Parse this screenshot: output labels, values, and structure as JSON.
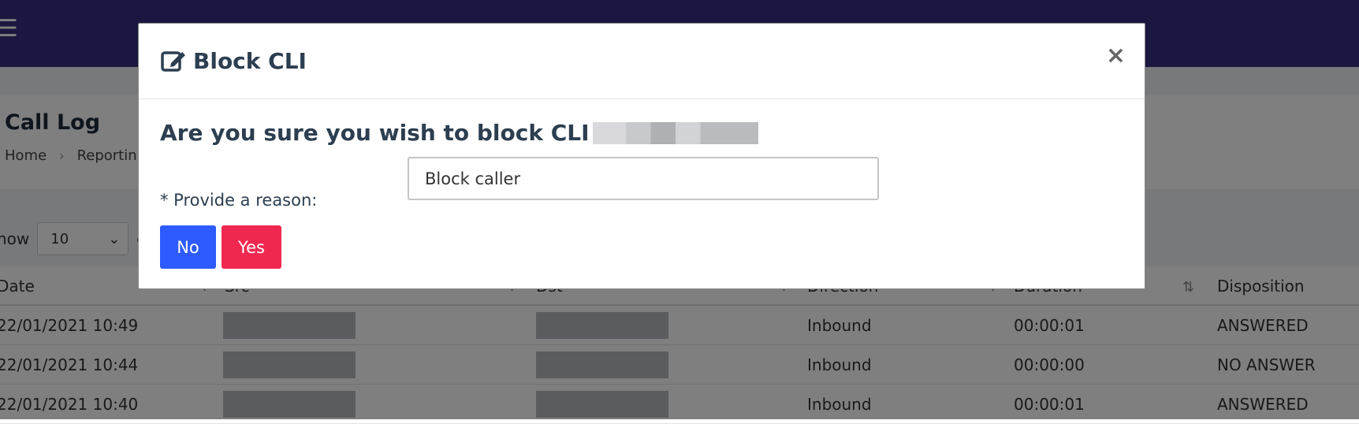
{
  "background": {
    "page_title": "Call Log",
    "breadcrumb": [
      "Home",
      "Reportin"
    ],
    "show_label": "how",
    "show_value": "10",
    "show_suffix": "e",
    "table": {
      "headers": [
        "Date",
        "Src",
        "Dst",
        "Direction",
        "Duration",
        "Disposition"
      ],
      "rows": [
        {
          "date": "22/01/2021 10:49",
          "direction": "Inbound",
          "duration": "00:00:01",
          "disposition": "ANSWERED"
        },
        {
          "date": "22/01/2021 10:44",
          "direction": "Inbound",
          "duration": "00:00:00",
          "disposition": "NO ANSWER"
        },
        {
          "date": "22/01/2021 10:40",
          "direction": "Inbound",
          "duration": "00:00:01",
          "disposition": "ANSWERED"
        }
      ]
    }
  },
  "modal": {
    "title": "Block CLI",
    "question": "Are you sure you wish to block CLI",
    "reason_label": "* Provide a reason:",
    "reason_value": "Block caller",
    "no_label": "No",
    "yes_label": "Yes",
    "close_symbol": "×"
  },
  "colors": {
    "topbar": "#352f80",
    "no_button": "#2e5bff",
    "yes_button": "#f0284f"
  }
}
